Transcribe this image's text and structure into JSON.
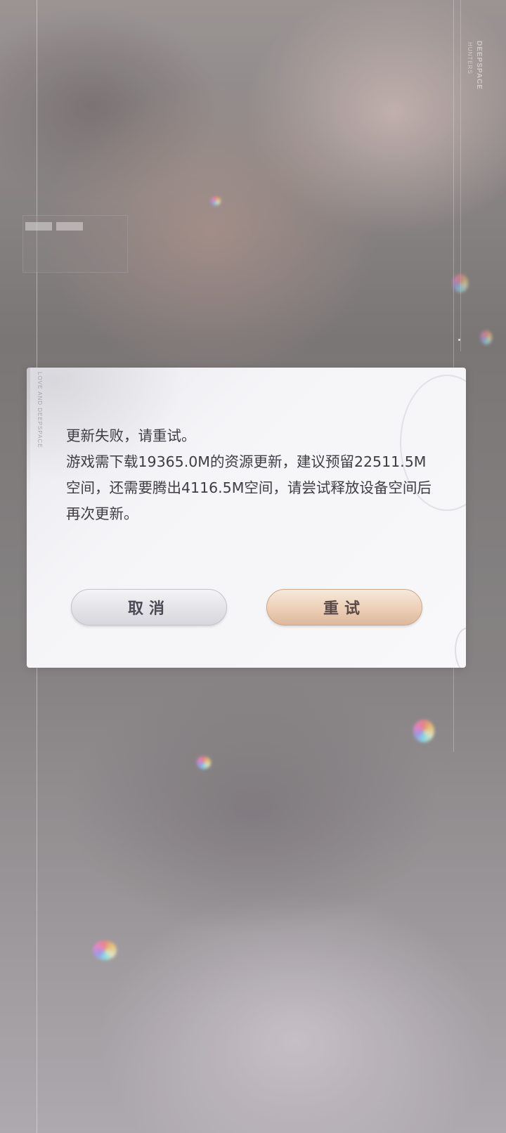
{
  "background": {
    "brand_vertical": "DEEPSPACE",
    "brand_sub": "HUNTERS"
  },
  "dialog": {
    "brand_vertical": "LOVE AND DEEPSPACE",
    "message_lines": [
      "更新失败，请重试。",
      "游戏需下载19365.0M的资源更新，建议预留22511.5M空间，还需要腾出4116.5M空间，请尝试释放设备空间后再次更新。"
    ],
    "cancel_label": "取消",
    "retry_label": "重试"
  },
  "colors": {
    "dialog_text": "#3f3c44",
    "cancel_button": "#e3e3e8",
    "retry_button": "#eccfb6"
  }
}
